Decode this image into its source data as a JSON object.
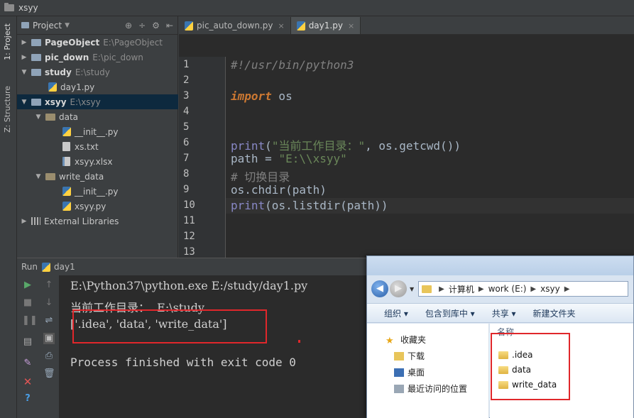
{
  "window": {
    "title": "xsyy"
  },
  "sidebar_tabs": {
    "project": "1: Project",
    "structure": "Z: Structure"
  },
  "project_panel": {
    "label": "Project",
    "items": [
      {
        "name": "PageObject",
        "path": "E:\\PageObject"
      },
      {
        "name": "pic_down",
        "path": "E:\\pic_down"
      },
      {
        "name": "study",
        "path": "E:\\study"
      },
      {
        "name": "day1.py"
      },
      {
        "name": "xsyy",
        "path": "E:\\xsyy"
      },
      {
        "name": "data"
      },
      {
        "name": "__init__.py"
      },
      {
        "name": "xs.txt"
      },
      {
        "name": "xsyy.xlsx"
      },
      {
        "name": "write_data"
      },
      {
        "name": "__init__.py"
      },
      {
        "name": "xsyy.py"
      },
      {
        "name": "External Libraries"
      }
    ]
  },
  "editor": {
    "tabs": [
      {
        "label": "pic_auto_down.py"
      },
      {
        "label": "day1.py"
      }
    ],
    "line_numbers": [
      "1",
      "2",
      "3",
      "4",
      "5",
      "6",
      "7",
      "8",
      "9",
      "10",
      "11",
      "12",
      "13"
    ],
    "code": {
      "l1": "#!/usr/bin/python3",
      "l3_kw": "import",
      "l3_rest": " os",
      "l6_fn": "print",
      "l6_a": "(",
      "l6_str": "\"当前工作目录：\"",
      "l6_b": ", os.getcwd())",
      "l7_a": "path = ",
      "l7_str": "\"E:\\\\xsyy\"",
      "l8": "# 切换目录",
      "l9": "os.chdir(path)",
      "l10_fn": "print",
      "l10_b": "(os.listdir(path))"
    }
  },
  "run_panel": {
    "label": "Run",
    "config": "day1",
    "output": [
      "E:\\Python37\\python.exe E:/study/day1.py",
      "当前工作目录：  E:\\study",
      "['.idea', 'data', 'write_data']",
      "Process finished with exit code 0"
    ]
  },
  "explorer": {
    "breadcrumb": [
      "计算机",
      "work (E:)",
      "xsyy"
    ],
    "toolbar": [
      "组织 ▾",
      "包含到库中 ▾",
      "共享 ▾",
      "新建文件夹"
    ],
    "nav": [
      {
        "label": "收藏夹"
      },
      {
        "label": "下载"
      },
      {
        "label": "桌面"
      },
      {
        "label": "最近访问的位置"
      }
    ],
    "column_header": "名称",
    "files": [
      ".idea",
      "data",
      "write_data"
    ]
  }
}
